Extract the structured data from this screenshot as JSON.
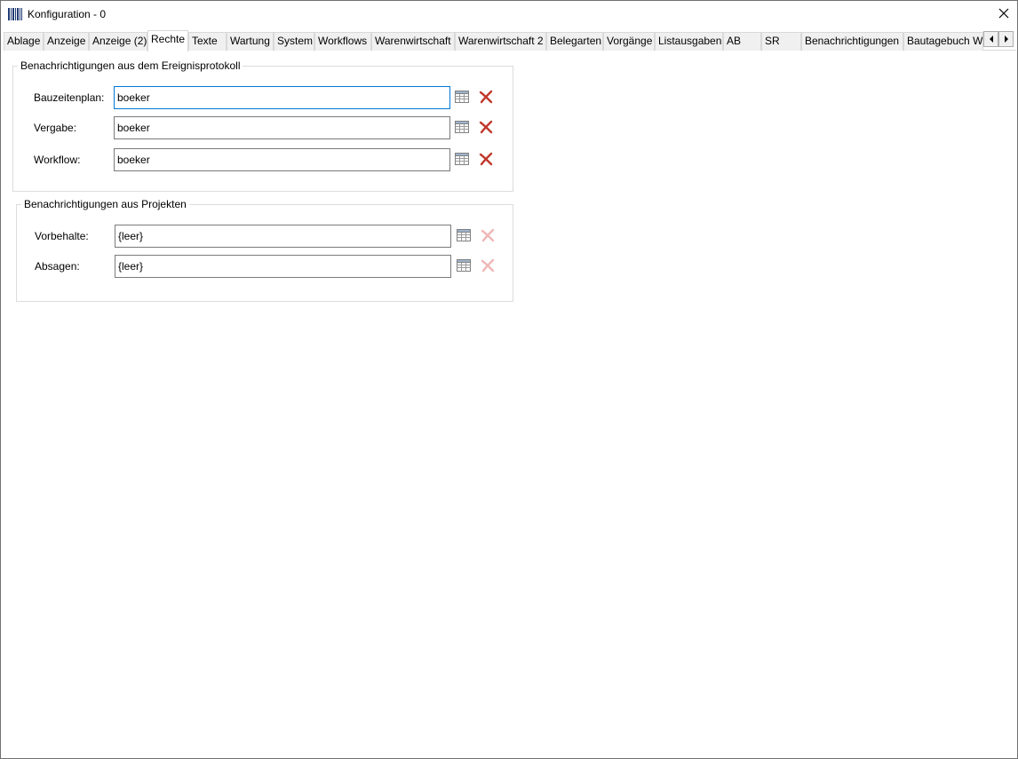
{
  "window": {
    "title": "Konfiguration - 0"
  },
  "tabs": [
    {
      "label": "Ablage"
    },
    {
      "label": "Anzeige"
    },
    {
      "label": "Anzeige (2)"
    },
    {
      "label": "Rechte",
      "active": true
    },
    {
      "label": "Texte"
    },
    {
      "label": "Wartung"
    },
    {
      "label": "System"
    },
    {
      "label": "Workflows"
    },
    {
      "label": "Warenwirtschaft"
    },
    {
      "label": "Warenwirtschaft 2"
    },
    {
      "label": "Belegarten"
    },
    {
      "label": "Vorgänge"
    },
    {
      "label": "Listausgaben"
    },
    {
      "label": "AB"
    },
    {
      "label": "SR"
    },
    {
      "label": "Benachrichtigungen"
    },
    {
      "label": "Bautagebuch W"
    }
  ],
  "groups": [
    {
      "title": "Benachrichtigungen aus dem Ereignisprotokoll",
      "fields": [
        {
          "label": "Bauzeitenplan:",
          "value": "boeker",
          "delete_enabled": true
        },
        {
          "label": "Vergabe:",
          "value": "boeker",
          "delete_enabled": true
        },
        {
          "label": "Workflow:",
          "value": "boeker",
          "delete_enabled": true
        }
      ]
    },
    {
      "title": "Benachrichtigungen aus Projekten",
      "fields": [
        {
          "label": "Vorbehalte:",
          "value": "{leer}",
          "delete_enabled": false
        },
        {
          "label": "Absagen:",
          "value": "{leer}",
          "delete_enabled": false
        }
      ]
    }
  ],
  "icons": {
    "app": "barcode-icon",
    "close": "close-icon",
    "select": "table-icon",
    "delete": "red-x-icon",
    "scroll_left": "arrow-left-icon",
    "scroll_right": "arrow-right-icon"
  },
  "colors": {
    "delete_active": "#c0392b",
    "delete_disabled": "#f0b7b7",
    "focus_border": "#0078d7"
  }
}
